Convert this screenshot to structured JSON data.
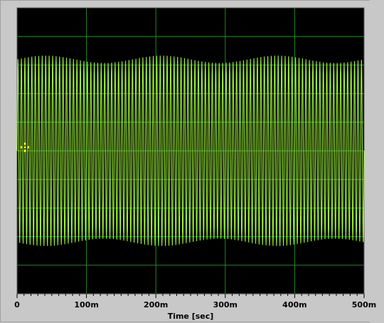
{
  "chart_data": {
    "type": "line",
    "title": "",
    "xlabel": "Time [sec]",
    "ylabel": "",
    "xlim": [
      0,
      0.5
    ],
    "ylim": [
      -1.0,
      1.0
    ],
    "x_ticks": [
      0,
      0.1,
      0.2,
      0.3,
      0.4,
      0.5
    ],
    "x_tick_labels": [
      "0",
      "100m",
      "200m",
      "300m",
      "400m",
      "500m"
    ],
    "y_gridlines": [
      -0.8,
      -0.6,
      -0.4,
      -0.2,
      0.0,
      0.2,
      0.4,
      0.6,
      0.8
    ],
    "grid": true,
    "series": [
      {
        "color": "#a6ff3c",
        "frequency_hz": 200,
        "amplitude": 0.64,
        "offset": 0.0,
        "samples_per_cycle": 4
      }
    ],
    "plot_background": "#000000",
    "grid_color": "#1e8c1e",
    "cursor_color": "#ffff00"
  }
}
